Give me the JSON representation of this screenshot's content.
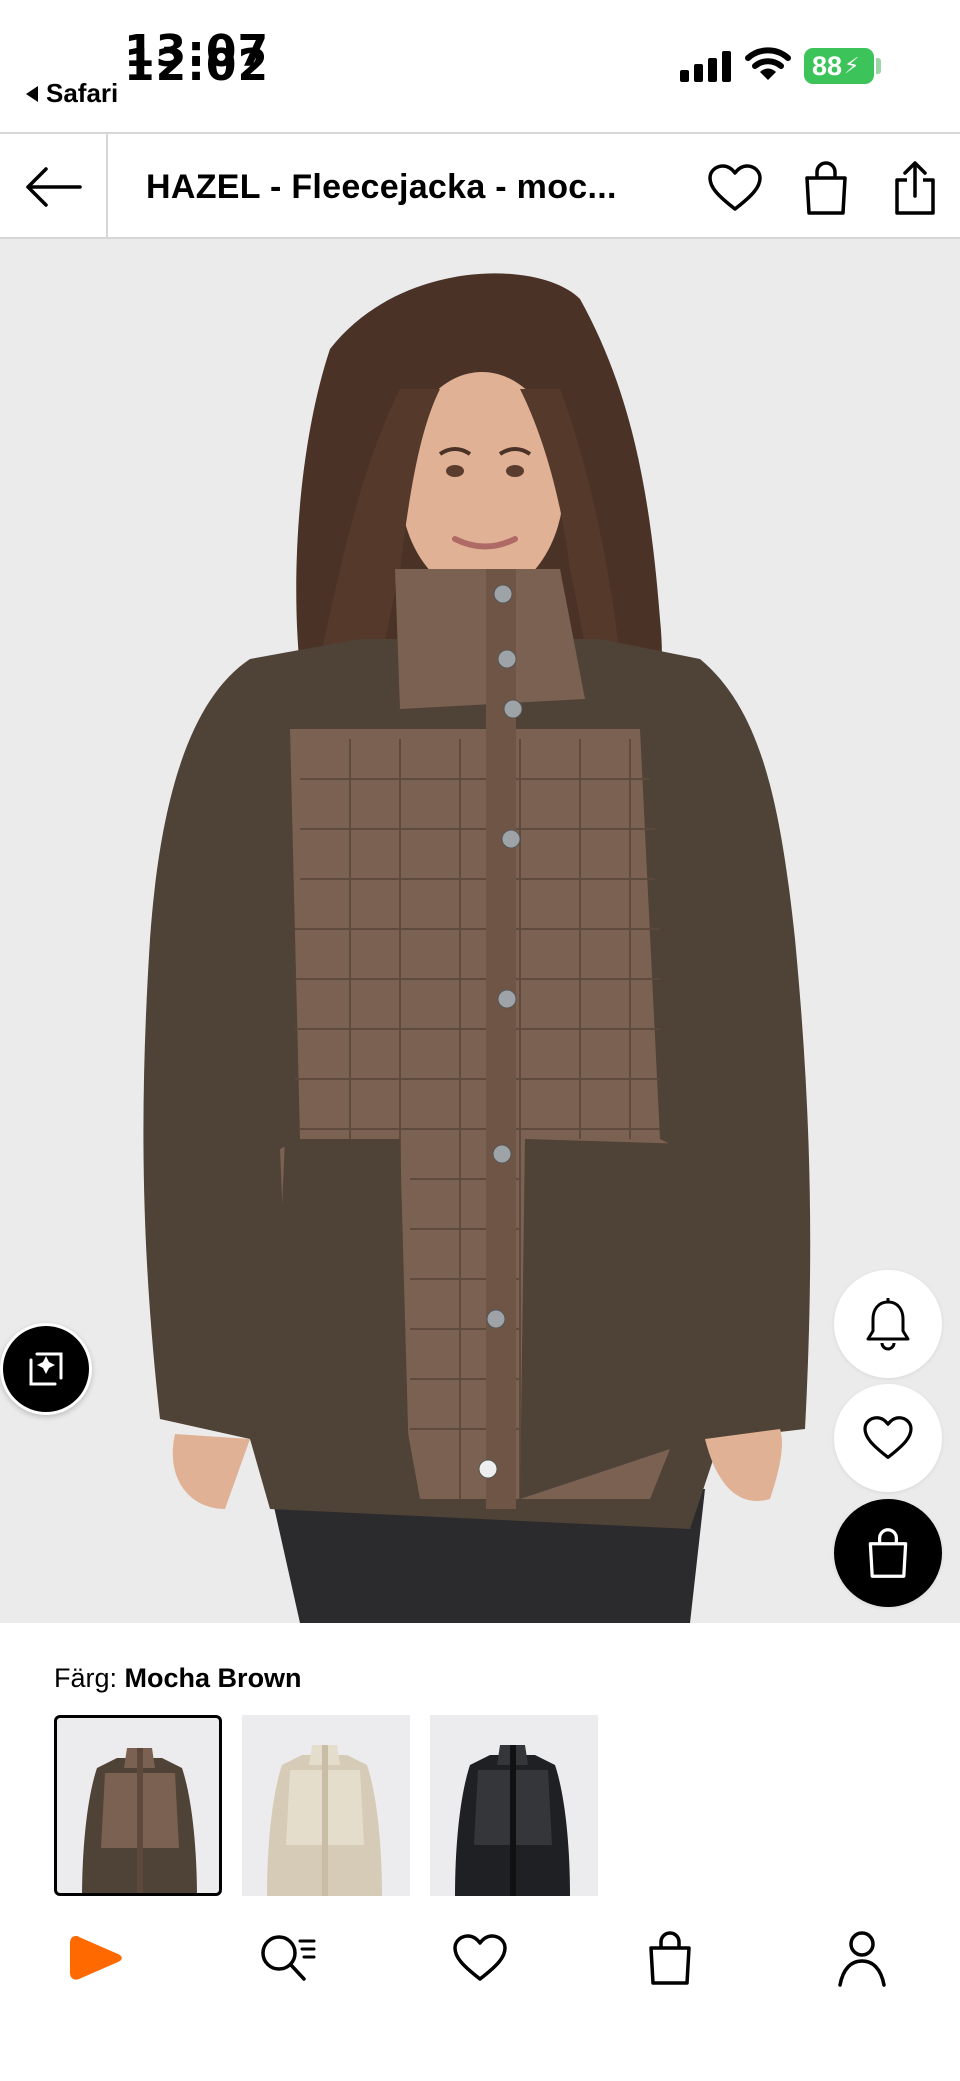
{
  "status_bar": {
    "time_primary": "13:07",
    "time_overlay": "12:02",
    "back_app": "Safari",
    "battery": "88"
  },
  "header": {
    "title": "HAZEL - Fleecejacka - moc...",
    "icons": [
      "back-arrow-icon",
      "heart-icon",
      "bag-icon",
      "share-icon"
    ]
  },
  "product": {
    "image": "model wearing brown quilted fleece jacket",
    "side_actions": [
      "bell-icon",
      "heart-icon",
      "add-to-bag-icon"
    ]
  },
  "colour": {
    "label": "Färg:",
    "selected": "Mocha Brown",
    "swatches": [
      {
        "name": "mocha brown",
        "color": "#6b5548",
        "selected": true
      },
      {
        "name": "beige",
        "color": "#d9d0bf",
        "selected": false
      },
      {
        "name": "black",
        "color": "#2a2b2e",
        "selected": false
      }
    ]
  },
  "bottom_nav": {
    "items": [
      "home-icon",
      "search-icon",
      "wishlist-icon",
      "bag-icon",
      "profile-icon"
    ],
    "accent": "#ff6900"
  }
}
